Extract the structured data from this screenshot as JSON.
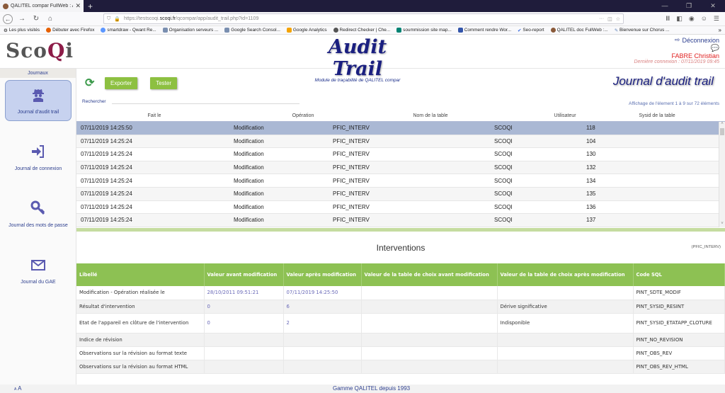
{
  "browser": {
    "tab_title": "QALITEL compar FullWeb : Au",
    "url_prefix": "https://testscoqi.",
    "url_domain": "scoqi.fr",
    "url_path": "/qcompar/app/audit_trail.php?id=1109",
    "bookmarks": [
      "Les plus visités",
      "Débuter avec Firefox",
      "smartdraw - Qwant Re...",
      "Organisation serveurs ...",
      "Google Search Consol...",
      "Google Analytics",
      "Redirect Checker | Che...",
      "soummission site map...",
      "Comment rendre Wor...",
      "Seo-report",
      "QALITEL doc FullWeb :...",
      "Bienvenue sur Chorus ..."
    ]
  },
  "header": {
    "logo_a": "Sco",
    "logo_b": "Q",
    "logo_c": "i",
    "title": "Audit Trail",
    "subtitle": "Module de traçabilité de QALITEL compar",
    "logout": "Déconnexion",
    "user": "FABRE Christian",
    "last_connection": "Dernière connexion : 07/11/2019 09:45"
  },
  "sidebar": {
    "title": "Journaux",
    "items": [
      {
        "label": "Journal d'audit trail",
        "icon": "spy-icon",
        "active": true
      },
      {
        "label": "Journal de connexion",
        "icon": "sign-in-icon"
      },
      {
        "label": "Journal des mots de passe",
        "icon": "key-icon"
      },
      {
        "label": "Journal du GAE",
        "icon": "envelope-icon"
      }
    ]
  },
  "toolbar": {
    "export": "Exporter",
    "test": "Tester",
    "page_title": "Journal d'audit trail",
    "search_label": "Rechercher",
    "info": "Affichage de l'élement 1 à 9 sur 72 éléments"
  },
  "grid": {
    "columns": [
      "Fait le",
      "Opération",
      "Nom de la table",
      "Utilisateur",
      "Sysid de la table"
    ],
    "rows": [
      [
        "07/11/2019 14:25:50",
        "Modification",
        "PFIC_INTERV",
        "SCOQI",
        "118"
      ],
      [
        "07/11/2019 14:25:24",
        "Modification",
        "PFIC_INTERV",
        "SCOQI",
        "104"
      ],
      [
        "07/11/2019 14:25:24",
        "Modification",
        "PFIC_INTERV",
        "SCOQI",
        "130"
      ],
      [
        "07/11/2019 14:25:24",
        "Modification",
        "PFIC_INTERV",
        "SCOQI",
        "132"
      ],
      [
        "07/11/2019 14:25:24",
        "Modification",
        "PFIC_INTERV",
        "SCOQI",
        "134"
      ],
      [
        "07/11/2019 14:25:24",
        "Modification",
        "PFIC_INTERV",
        "SCOQI",
        "135"
      ],
      [
        "07/11/2019 14:25:24",
        "Modification",
        "PFIC_INTERV",
        "SCOQI",
        "136"
      ],
      [
        "07/11/2019 14:25:24",
        "Modification",
        "PFIC_INTERV",
        "SCOQI",
        "137"
      ]
    ]
  },
  "interventions": {
    "title": "Interventions",
    "table_name": "(PFIC_INTERV)",
    "columns": [
      "Libellé",
      "Valeur avant modification",
      "Valeur après modification",
      "Valeur de la table de choix avant modification",
      "Valeur de la table de choix après modification",
      "Code SQL"
    ],
    "rows": [
      [
        "Modification - Opération réalisée le",
        "28/10/2011 09:51:21",
        "07/11/2019 14:25:50",
        "",
        "",
        "PINT_SDTE_MODIF"
      ],
      [
        "Résultat d'intervention",
        "0",
        "6",
        "",
        "Dérive significative",
        "PINT_SYSID_RESINT"
      ],
      [
        "Etat de l'appareil en clôture de l'intervention",
        "0",
        "2",
        "",
        "Indisponible",
        "PINT_SYSID_ETATAPP_CLOTURE"
      ],
      [
        "Indice de révision",
        "",
        "",
        "",
        "",
        "PINT_NO_REVISION"
      ],
      [
        "Observations sur la révision au format texte",
        "",
        "",
        "",
        "",
        "PINT_OBS_REV"
      ],
      [
        "Observations sur la révision au format HTML",
        "",
        "",
        "",
        "",
        "PINT_OBS_REV_HTML"
      ]
    ]
  },
  "footer": {
    "font_small": "A",
    "font_large": "A",
    "text": "Gamme QALITEL depuis 1993"
  }
}
